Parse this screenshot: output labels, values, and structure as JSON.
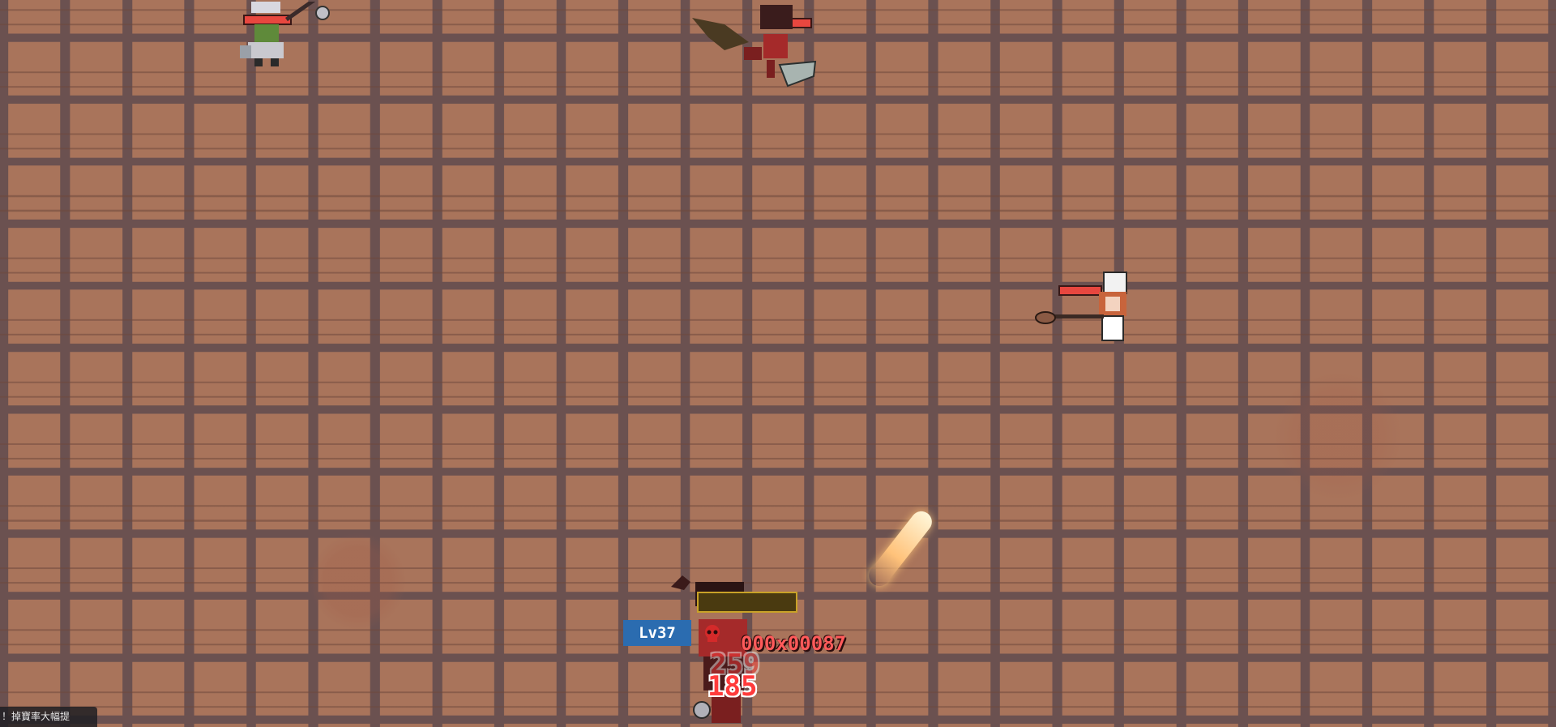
{
  "hud": {
    "player_level": "Lv37",
    "player_name": "000x00087",
    "title_plate": "",
    "notice": "！掉寶率大幅提"
  },
  "combat": {
    "damage_numbers": [
      "259",
      "185"
    ]
  },
  "enemies": [
    {
      "id": "goblin-mace"
    },
    {
      "id": "bat-demon-axe"
    },
    {
      "id": "chef-girl-ladle"
    }
  ],
  "colors": {
    "hp_bar": "#e8473f",
    "level_badge": "#2b6cb0",
    "name_text": "#ff5a5a",
    "floor_brick": "#a9745b",
    "floor_grout": "#6b5150"
  }
}
